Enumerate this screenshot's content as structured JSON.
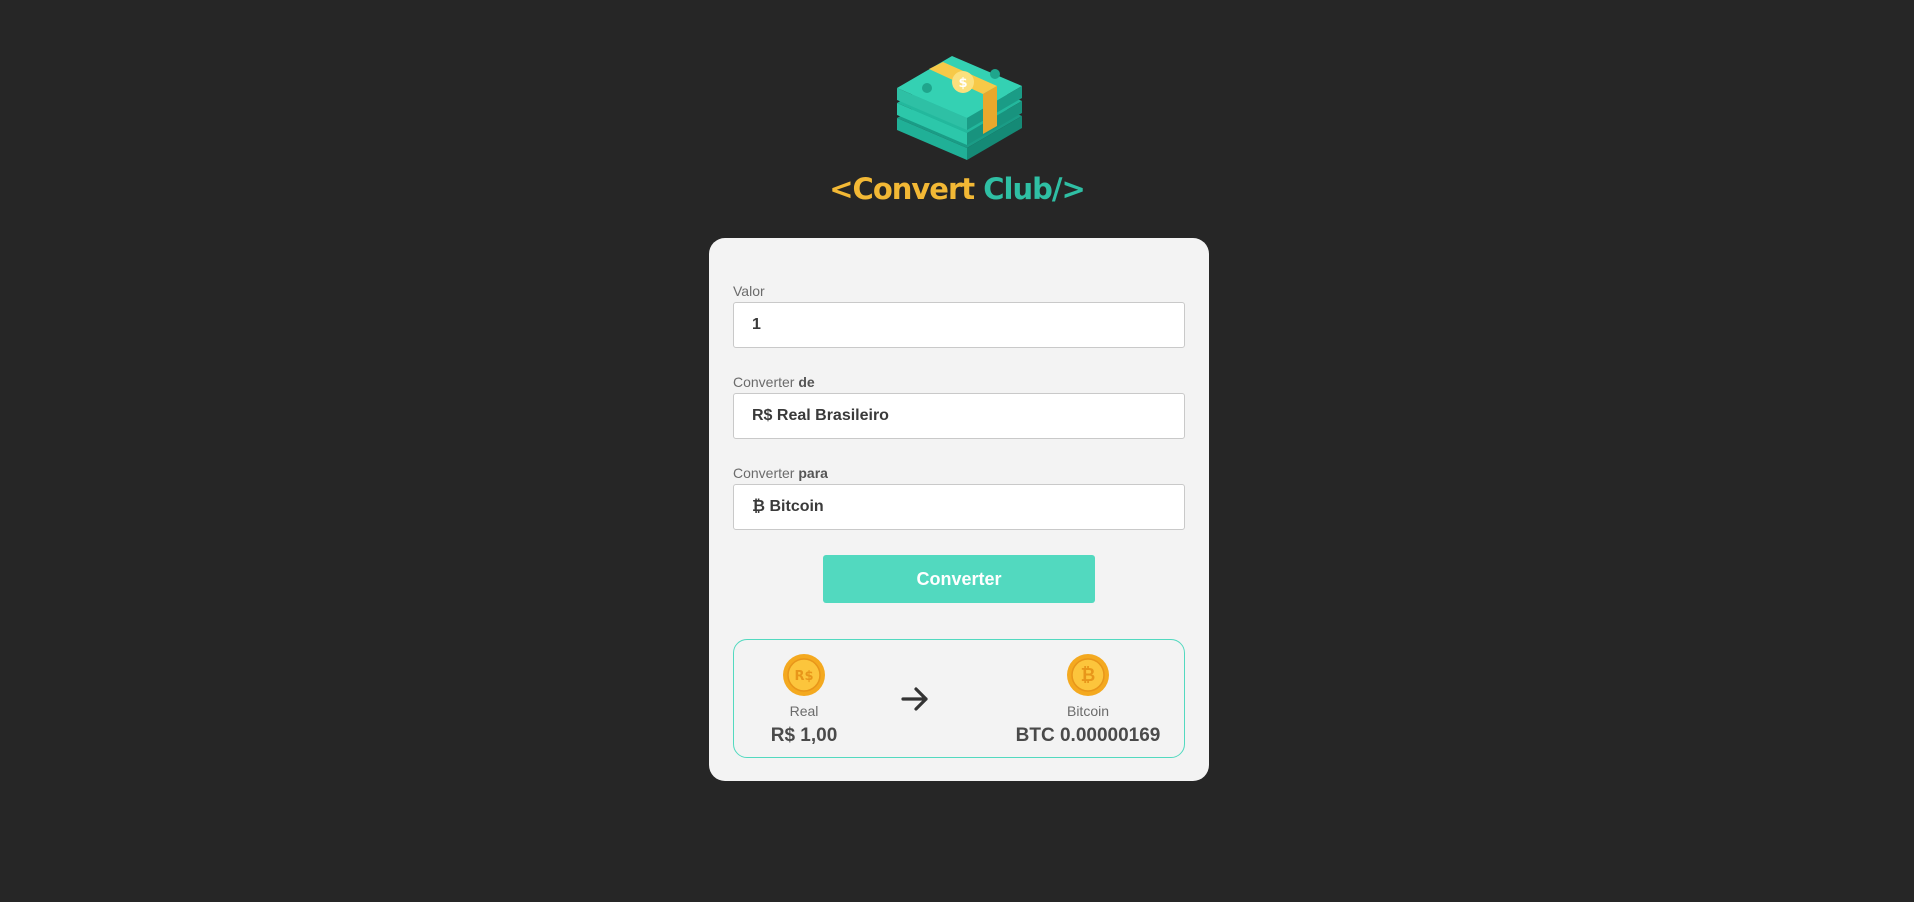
{
  "brand": {
    "logo_icon": "money-stack-icon",
    "name_part1": "<Convert",
    "name_part2": "Club/>"
  },
  "form": {
    "value_field": {
      "label": "Valor",
      "value": "1"
    },
    "from_field": {
      "label": "Converter",
      "label_bold": "de",
      "value": "R$ Real Brasileiro"
    },
    "to_field": {
      "label": "Converter",
      "label_bold": "para",
      "value": "₿ Bitcoin"
    },
    "convert_button_label": "Converter"
  },
  "result": {
    "from_currency": {
      "icon": "real-coin-icon",
      "name": "Real",
      "amount": "R$ 1,00"
    },
    "arrow_icon": "arrow-right-icon",
    "to_currency": {
      "icon": "bitcoin-coin-icon",
      "name": "Bitcoin",
      "amount": "BTC 0.00000169"
    }
  },
  "colors": {
    "background": "#262626",
    "card": "#f3f3f3",
    "accent": "#52d9bf",
    "brand_yellow": "#f2b835",
    "brand_teal": "#2fbfa4"
  }
}
